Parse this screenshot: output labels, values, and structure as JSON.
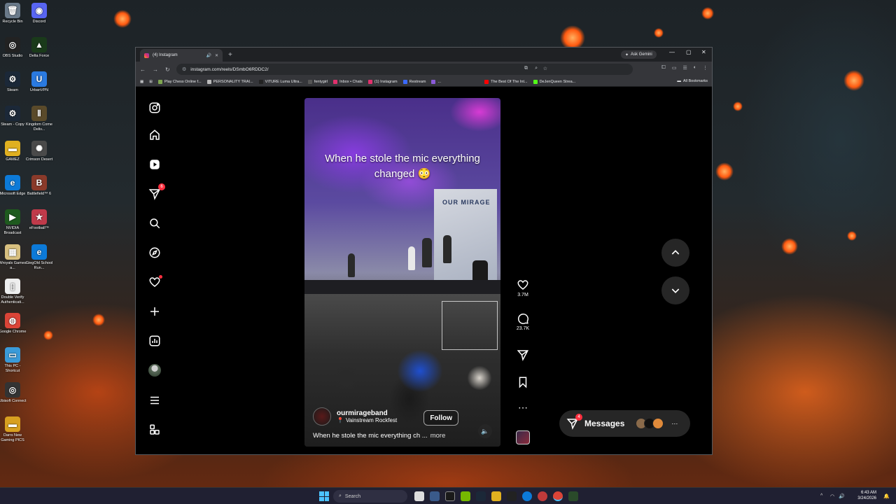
{
  "desktop": {
    "icons": [
      {
        "label": "Recycle Bin",
        "color": "#6a7a8a",
        "glyph": "🗑"
      },
      {
        "label": "Discord",
        "color": "#5865f2",
        "glyph": "◉"
      },
      {
        "label": "OBS Studio",
        "color": "#222222",
        "glyph": "◎"
      },
      {
        "label": "Delta Force",
        "color": "#1a3a1a",
        "glyph": "▲"
      },
      {
        "label": "Steam",
        "color": "#1b2838",
        "glyph": "⚙"
      },
      {
        "label": "UrbanVPN",
        "color": "#2a7ae0",
        "glyph": "U"
      },
      {
        "label": "Steam - Copy",
        "color": "#1b2838",
        "glyph": "⚙"
      },
      {
        "label": "Kingdom Come Deliv...",
        "color": "#5a4a2a",
        "glyph": "Ⅱ"
      },
      {
        "label": "GAMEZ",
        "color": "#e0b020",
        "glyph": "▬"
      },
      {
        "label": "Crimson Desert",
        "color": "#4a4a4a",
        "glyph": "✺"
      },
      {
        "label": "Microsoft Edge",
        "color": "#0c7ad8",
        "glyph": "e"
      },
      {
        "label": "Battlefield™ 6",
        "color": "#8a3a2a",
        "glyph": "B"
      },
      {
        "label": "NVIDIA Broadcast",
        "color": "#1e5a1e",
        "glyph": "▶"
      },
      {
        "label": "eFootball™",
        "color": "#c03a4a",
        "glyph": "★"
      },
      {
        "label": "Wroyals Games a...",
        "color": "#d8c080",
        "glyph": "▦"
      },
      {
        "label": "GiegOld School Run...",
        "color": "#0c7ad8",
        "glyph": "e"
      },
      {
        "label": "Double Verify Authenticati...",
        "color": "#eeeeee",
        "glyph": "▯"
      },
      {
        "label": "Google Chrome",
        "color": "#db4437",
        "glyph": "◍"
      },
      {
        "label": "This PC - Shortcut",
        "color": "#3a9ad8",
        "glyph": "▭"
      },
      {
        "label": "Ubisoft Connect",
        "color": "#333333",
        "glyph": "◎"
      },
      {
        "label": "Darrs New Gaming PICS",
        "color": "#d8a020",
        "glyph": "▬"
      }
    ]
  },
  "browser": {
    "tab_title": "(4) Instagram",
    "ask_gemini": "Ask Gemini",
    "url": "instagram.com/reels/DSmbO6RDDC2/",
    "bookmarks": [
      {
        "label": "Play Chess Online f...",
        "color": "#7fa650"
      },
      {
        "label": "PERSONALITY TRAI...",
        "color": "#bbbbbb"
      },
      {
        "label": "VITURE Luma Ultra...",
        "color": "#222222"
      },
      {
        "label": "fentygirl",
        "color": "#555555"
      },
      {
        "label": "Inbox • Chats",
        "color": "#e1306c"
      },
      {
        "label": "(1) Instagram",
        "color": "#e1306c"
      },
      {
        "label": "Restream",
        "color": "#3a6aff"
      },
      {
        "label": "...",
        "color": "#8a5ad8"
      },
      {
        "label": "The Best Of The Int...",
        "color": "#ff0000"
      },
      {
        "label": "DeJenQueen Strea...",
        "color": "#53fc18"
      }
    ],
    "all_bookmarks": "All Bookmarks"
  },
  "instagram": {
    "nav": [
      {
        "name": "instagram-logo-icon"
      },
      {
        "name": "home-icon"
      },
      {
        "name": "reels-icon"
      },
      {
        "name": "messages-icon",
        "badge": "6"
      },
      {
        "name": "search-icon"
      },
      {
        "name": "explore-icon"
      },
      {
        "name": "notifications-icon"
      },
      {
        "name": "create-icon"
      },
      {
        "name": "dashboard-icon"
      },
      {
        "name": "profile-avatar"
      },
      {
        "name": "menu-icon"
      },
      {
        "name": "also-from-meta-icon"
      }
    ],
    "reel": {
      "overlay_caption": "When he stole the mic everything changed 😳",
      "screen_text": "OUR MIRAGE",
      "author": "ourmirageband",
      "location": "Vainstream Rockfest",
      "follow_label": "Follow",
      "description": "When he stole the mic everything ch ...",
      "more_label": "more"
    },
    "actions": {
      "likes": "3.7M",
      "comments": "23.7K"
    },
    "messages_label": "Messages",
    "messages_badge": "4"
  },
  "taskbar": {
    "search_label": "Search",
    "time": "6:43 AM",
    "date": "3/24/2026"
  },
  "colors": {
    "badge_red": "#ff3040",
    "ig_button_bg": "#262626"
  }
}
